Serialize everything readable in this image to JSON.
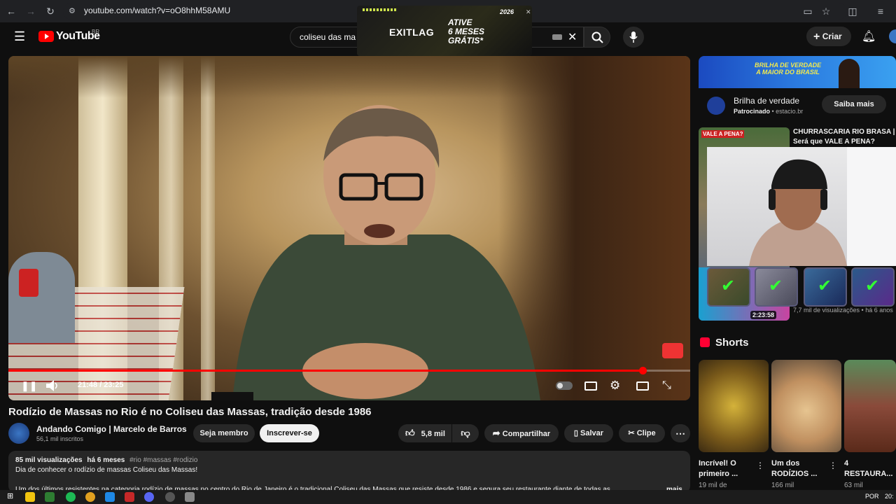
{
  "browser": {
    "url": "youtube.com/watch?v=oO8hhM58AMU"
  },
  "header": {
    "logo_text": "YouTube",
    "logo_region": "BR",
    "search_value": "coliseu das ma",
    "create_label": "Criar"
  },
  "exit_ad": {
    "brand": "EXITLAG",
    "line1": "ATIVE",
    "line2": "6 MESES",
    "line3": "GRÁTIS*",
    "badge": "2026"
  },
  "player": {
    "time": "21:48 / 23:25",
    "progress": 0.93
  },
  "video": {
    "title": "Rodízio de Massas no Rio é no Coliseu das Massas, tradição desde 1986",
    "channel": "Andando Comigo | Marcelo de Barros",
    "subscribers": "56,1 mil inscritos",
    "member_label": "Seja membro",
    "subscribe_label": "Inscrever-se",
    "likes": "5,8 mil",
    "share_label": "Compartilhar",
    "save_label": "Salvar",
    "clip_label": "Clipe"
  },
  "description": {
    "views": "85 mil visualizações",
    "date": "há 6 meses",
    "tags": "#rio #massas #rodizio",
    "line1": "Dia de conhecer o rodízio de massas Coliseu das Massas!",
    "line2": "Um dos últimos resistentes na categoria rodízio de massas no centro do Rio de Janeiro é o tradicional Coliseu das Massas que resiste desde 1986 e segura seu restaurante diante de todas as ...",
    "more": "mais"
  },
  "sidebar_ad": {
    "banner_line1": "BRILHA DE VERDADE",
    "banner_line2": "A MAIOR DO BRASIL",
    "title": "Brilha de verdade",
    "sponsored": "Patrocinado",
    "domain": "estacio.br",
    "cta": "Saiba mais"
  },
  "rec1": {
    "thumb_text": "VALE A PENA?",
    "title_line1": "CHURRASCARIA RIO BRASA |",
    "title_line2": "Será que VALE A PENA?",
    "meta": "7,7 mil de visualizações • há 6 anos",
    "duration": "2:23:58"
  },
  "shorts": {
    "heading": "Shorts",
    "items": [
      {
        "title": "Incrível! O primeiro ...",
        "meta": "19 mil de"
      },
      {
        "title": "Um dos RODÍZIOS ...",
        "meta": "166 mil"
      },
      {
        "title": "4 RESTAURA...",
        "meta": "63 mil"
      }
    ]
  },
  "taskbar": {
    "lang": "POR",
    "clock": "20:"
  },
  "colors": {
    "accent_red": "#ff0000",
    "bg": "#0f0f0f"
  }
}
